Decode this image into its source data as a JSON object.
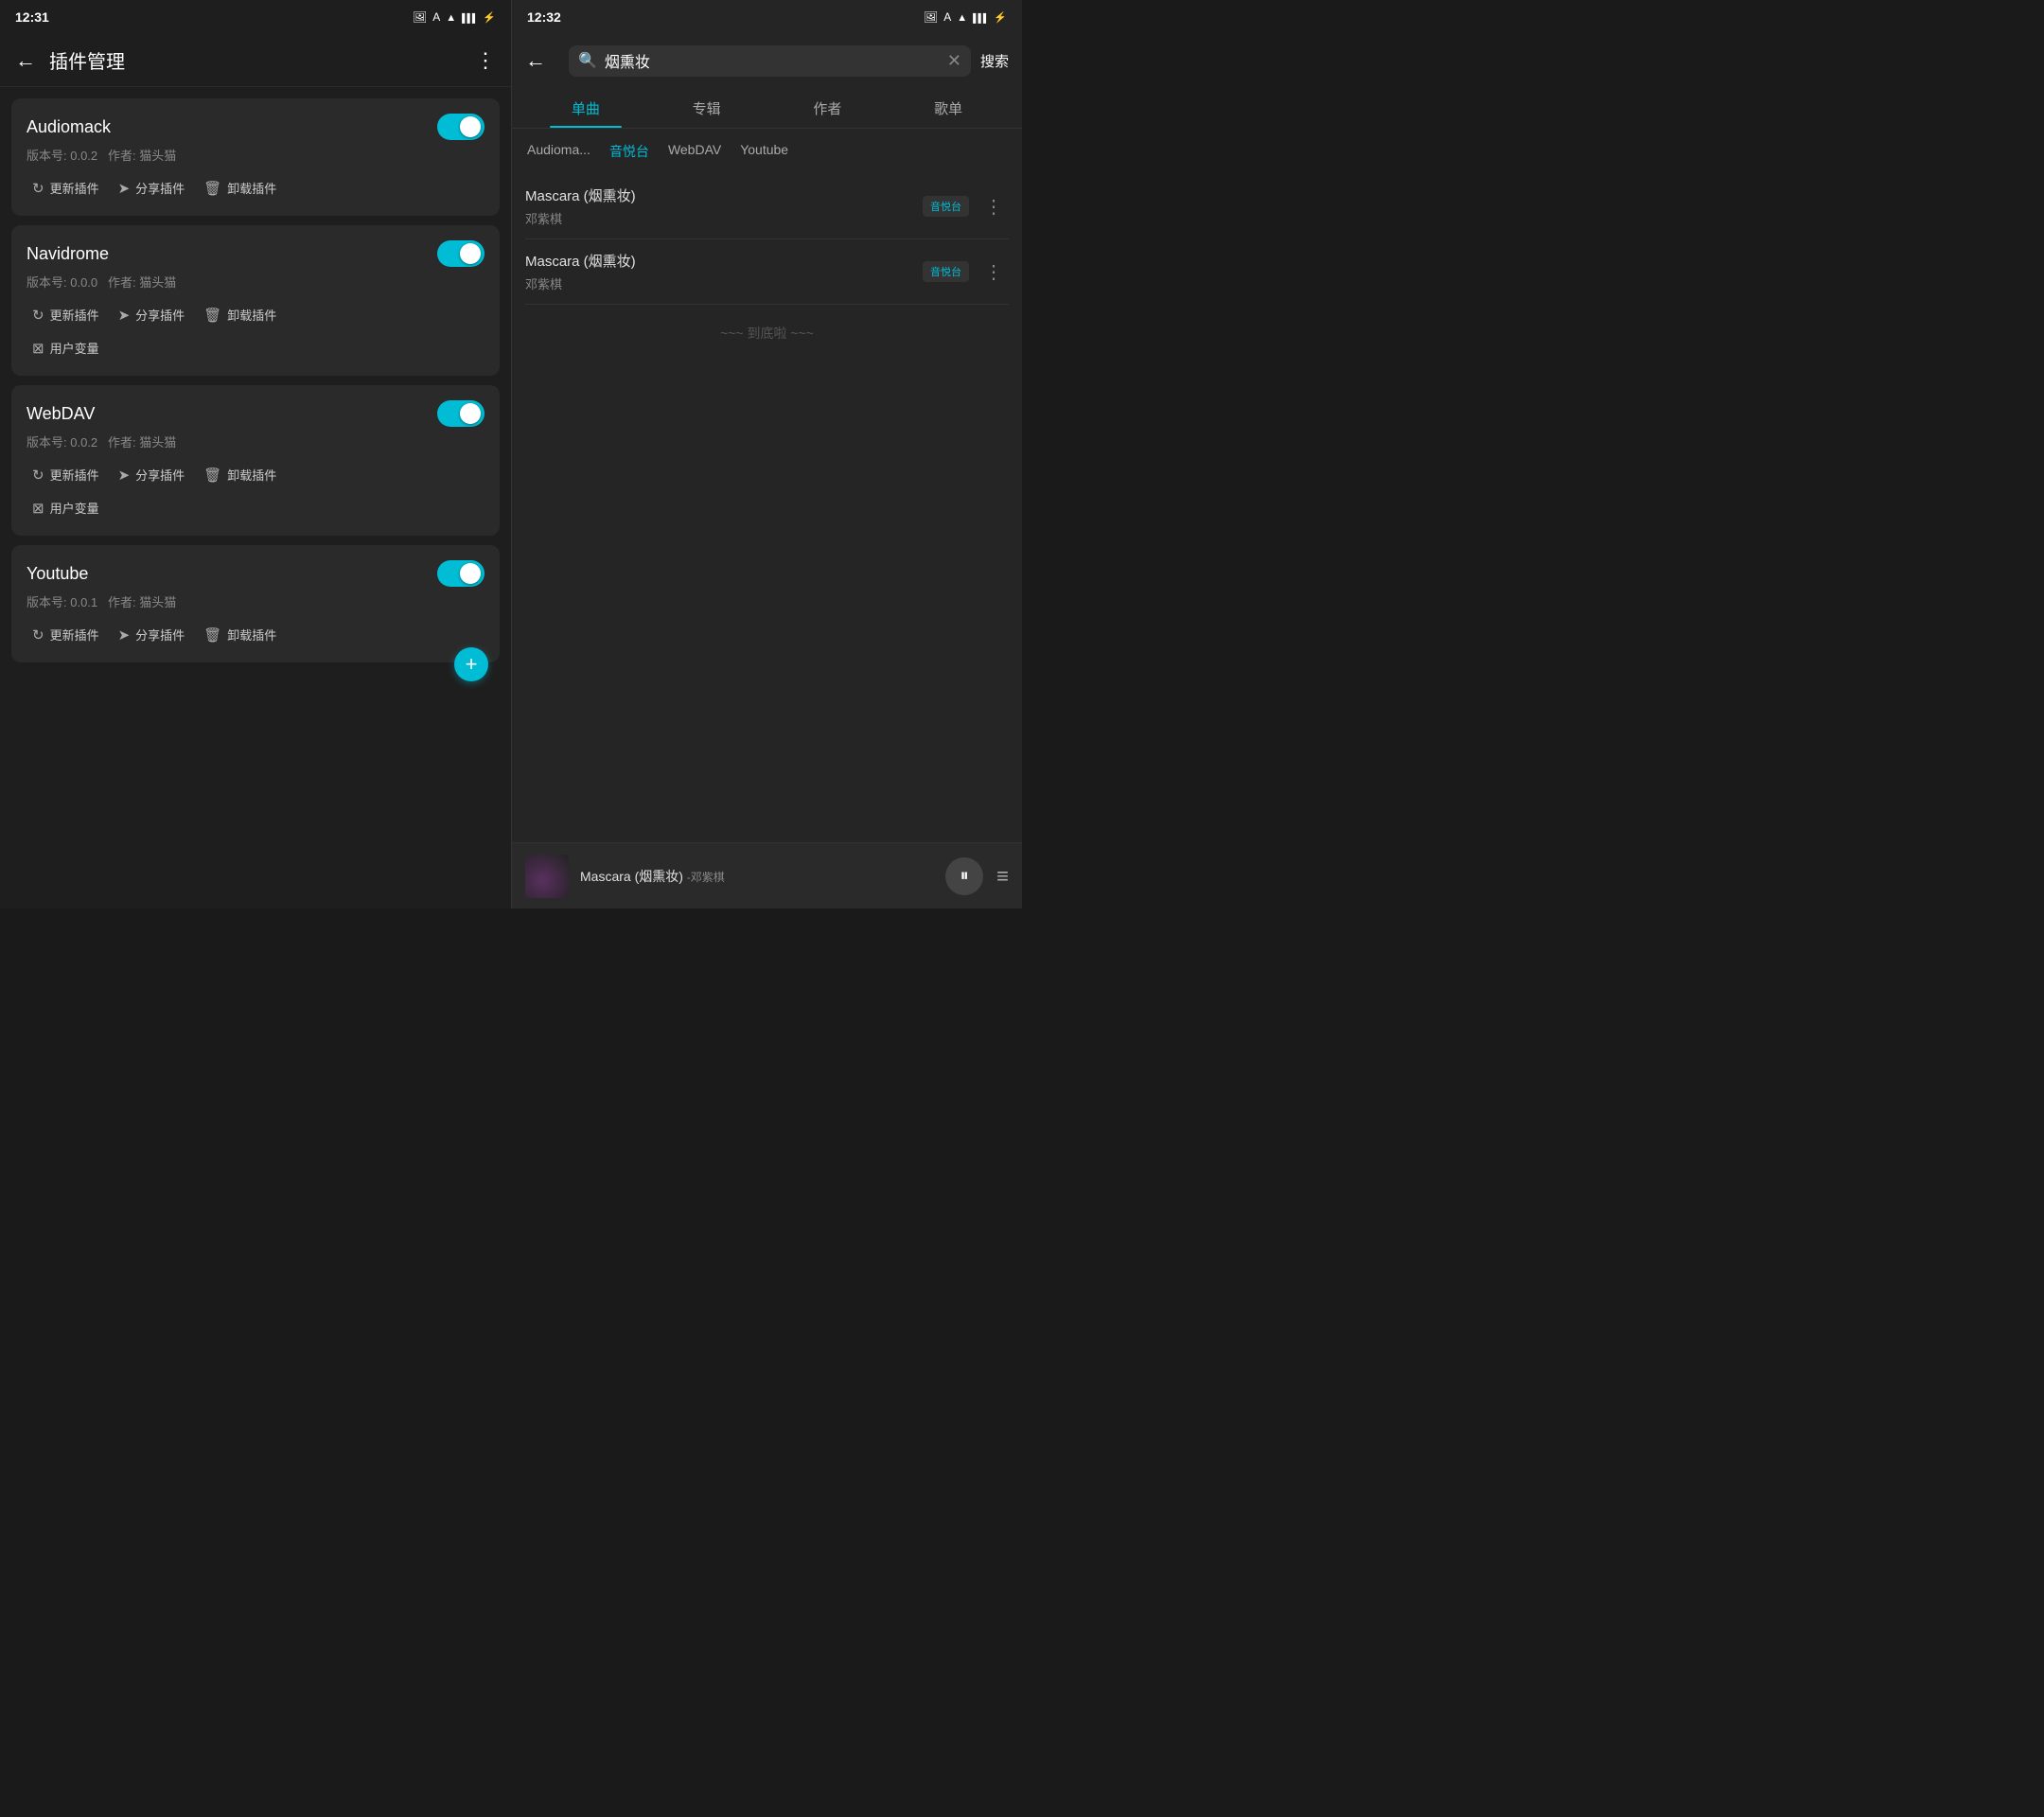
{
  "left": {
    "statusBar": {
      "time": "12:31"
    },
    "header": {
      "title": "插件管理",
      "backLabel": "←",
      "moreLabel": "⋮"
    },
    "plugins": [
      {
        "name": "Audiomack",
        "version": "版本号: 0.0.2",
        "author": "作者: 猫头猫",
        "enabled": true,
        "actions": [
          "更新插件",
          "分享插件",
          "卸载插件"
        ],
        "extraActions": []
      },
      {
        "name": "Navidrome",
        "version": "版本号: 0.0.0",
        "author": "作者: 猫头猫",
        "enabled": true,
        "actions": [
          "更新插件",
          "分享插件",
          "卸载插件"
        ],
        "extraActions": [
          "用户变量"
        ]
      },
      {
        "name": "WebDAV",
        "version": "版本号: 0.0.2",
        "author": "作者: 猫头猫",
        "enabled": true,
        "actions": [
          "更新插件",
          "分享插件",
          "卸载插件"
        ],
        "extraActions": [
          "用户变量"
        ]
      },
      {
        "name": "Youtube",
        "version": "版本号: 0.0.1",
        "author": "作者: 猫头猫",
        "enabled": true,
        "actions": [
          "更新插件",
          "分享插件",
          "卸载插件"
        ],
        "extraActions": []
      }
    ]
  },
  "right": {
    "statusBar": {
      "time": "12:32"
    },
    "header": {
      "backLabel": "←",
      "searchValue": "烟熏妆",
      "clearLabel": "✕",
      "confirmLabel": "搜索"
    },
    "tabs": [
      "单曲",
      "专辑",
      "作者",
      "歌单"
    ],
    "activeTab": 0,
    "sourceTabs": [
      "Audioma...",
      "音悦台",
      "WebDAV",
      "Youtube"
    ],
    "activeSourceTab": 1,
    "results": [
      {
        "title": "Mascara (烟熏妆)",
        "artist": "邓紫棋",
        "source": "音悦台"
      },
      {
        "title": "Mascara (烟熏妆)",
        "artist": "邓紫棋",
        "source": "音悦台"
      }
    ],
    "endText": "~~~ 到底啦 ~~~",
    "player": {
      "title": "Mascara (烟熏妆)",
      "artist": "-邓紫棋",
      "playPauseIcon": "⏸",
      "playlistIcon": "≡"
    }
  },
  "icons": {
    "back": "←",
    "more": "⋮",
    "update": "↻",
    "share": "➤",
    "delete": "🗑",
    "variable": "⊠",
    "search": "🔍",
    "clear": "✕",
    "pause": "⏸",
    "playlist": "≡",
    "plus": "+"
  }
}
